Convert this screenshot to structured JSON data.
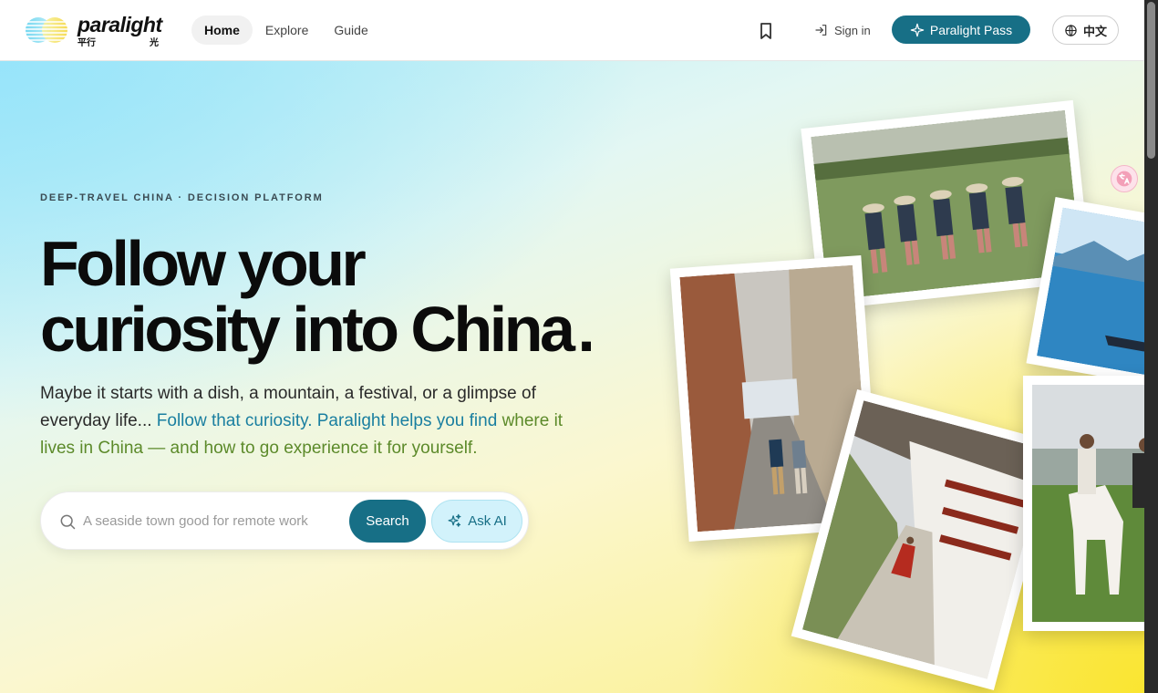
{
  "header": {
    "logo": {
      "wordmark": "paralight",
      "cn_left": "平行",
      "cn_right": "光"
    },
    "nav": [
      {
        "label": "Home",
        "active": true
      },
      {
        "label": "Explore",
        "active": false
      },
      {
        "label": "Guide",
        "active": false
      }
    ],
    "bookmark_icon": "bookmark-icon",
    "sign_in": "Sign in",
    "pass_button": "Paralight Pass",
    "language_button": "中文"
  },
  "hero": {
    "eyebrow": "DEEP-TRAVEL CHINA · DECISION PLATFORM",
    "headline_line1": "Follow your",
    "headline_line2": "curiosity into China",
    "headline_dot": ".",
    "intro_plain": "Maybe it starts with a dish, a mountain, a festival, or a glimpse of everyday life... ",
    "intro_highlight1": "Follow that curiosity. Paralight helps you find",
    "intro_highlight2": "where it lives in China — and how to go experience it for yourself.",
    "search": {
      "placeholder": "A seaside town good for remote work",
      "value": "",
      "search_button": "Search",
      "ask_button": "Ask AI"
    },
    "photos": [
      {
        "name": "rice-field-workers"
      },
      {
        "name": "lake-boat"
      },
      {
        "name": "old-town-street"
      },
      {
        "name": "monastery-monk"
      },
      {
        "name": "grassland-horse-riders"
      }
    ]
  },
  "colors": {
    "brand_teal": "#176f86",
    "hero_cyan": "#b5ecf7",
    "hero_yellow": "#fbef82",
    "highlight_blue": "#1a7fa0",
    "highlight_green": "#5c8a2a"
  }
}
